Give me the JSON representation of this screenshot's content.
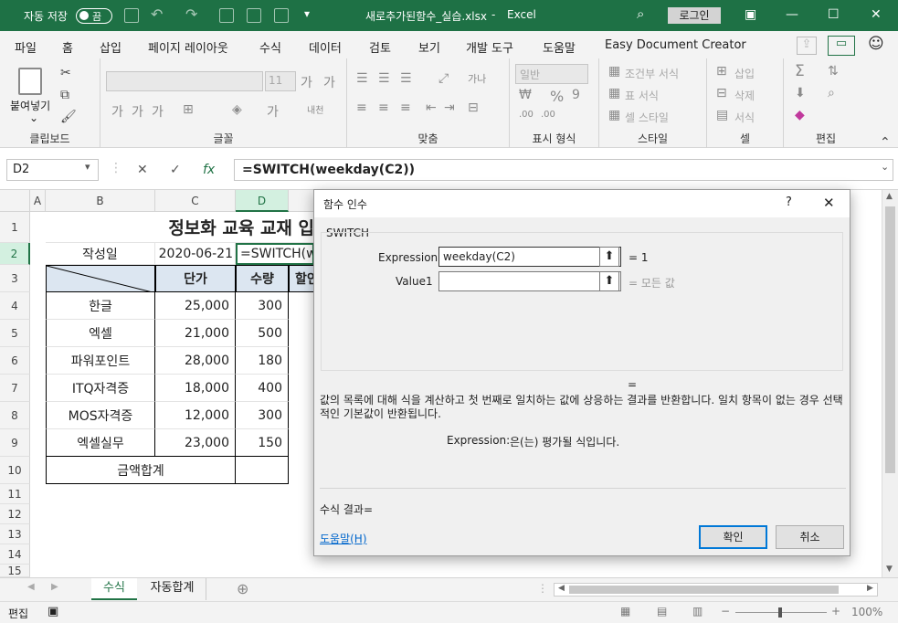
{
  "titlebar": {
    "autosave_label": "자동 저장",
    "autosave_state": "끔",
    "filename": "새로추가된함수_실습.xlsx",
    "app": "Excel",
    "login": "로그인"
  },
  "menu": [
    "파일",
    "홈",
    "삽입",
    "페이지 레이아웃",
    "수식",
    "데이터",
    "검토",
    "보기",
    "개발 도구",
    "도움말",
    "Easy Document Creator"
  ],
  "ribbon": {
    "clipboard": {
      "paste": "붙여넣기",
      "label": "클립보드"
    },
    "font": {
      "size": "11",
      "label": "글꼴"
    },
    "align": {
      "label": "맞춤"
    },
    "number": {
      "format": "일반",
      "label": "표시 형식"
    },
    "style": {
      "cond": "조건부 서식",
      "table": "표 서식",
      "cell": "셀 스타일",
      "label": "스타일"
    },
    "cells": {
      "insert": "삽입",
      "delete": "삭제",
      "format": "서식",
      "label": "셀"
    },
    "edit": {
      "label": "편집"
    }
  },
  "formulabar": {
    "namebox": "D2",
    "formula": "=SWITCH(weekday(C2))"
  },
  "columns": [
    "A",
    "B",
    "C",
    "D"
  ],
  "rows": [
    "1",
    "2",
    "3",
    "4",
    "5",
    "6",
    "7",
    "8",
    "9",
    "10",
    "11",
    "12",
    "13",
    "14",
    "15"
  ],
  "sheet": {
    "title": "정보화 교육 교재 입",
    "date_label": "작성일",
    "date_value": "2020-06-21",
    "formula_preview": "=SWITCH(w",
    "headers": [
      "단가",
      "수량",
      "할인"
    ],
    "items": [
      {
        "name": "한글",
        "price": "25,000",
        "qty": "300"
      },
      {
        "name": "엑셀",
        "price": "21,000",
        "qty": "500"
      },
      {
        "name": "파워포인트",
        "price": "28,000",
        "qty": "180"
      },
      {
        "name": "ITQ자격증",
        "price": "18,000",
        "qty": "400"
      },
      {
        "name": "MOS자격증",
        "price": "12,000",
        "qty": "300"
      },
      {
        "name": "엑셀실무",
        "price": "23,000",
        "qty": "150"
      }
    ],
    "total_label": "금액합계"
  },
  "dialog": {
    "title": "함수 인수",
    "help_q": "?",
    "close": "✕",
    "func_name": "SWITCH",
    "args": [
      {
        "label": "Expression",
        "value": "weekday(C2)",
        "result": "=  1"
      },
      {
        "label": "Value1",
        "value": "",
        "result": "=  모든 값"
      }
    ],
    "eq": "=",
    "description": "값의 목록에 대해 식을 계산하고 첫 번째로 일치하는 값에 상응하는 결과를 반환합니다. 일치 항목이 없는 경우 선택적인 기본값이 반환됩니다.",
    "arg_help_name": "Expression:",
    "arg_help_text": "은(는) 평가될 식입니다.",
    "result_label": "수식 결과=",
    "help_link": "도움말(H)",
    "ok": "확인",
    "cancel": "취소"
  },
  "tabs": [
    {
      "label": "수식",
      "active": true
    },
    {
      "label": "자동합계",
      "active": false
    }
  ],
  "status": {
    "mode": "편집",
    "zoom": "100%"
  },
  "colors": {
    "excel_green": "#1e7145",
    "accent": "#217346",
    "link": "#0066cc",
    "header_fill": "#dce6f1"
  }
}
